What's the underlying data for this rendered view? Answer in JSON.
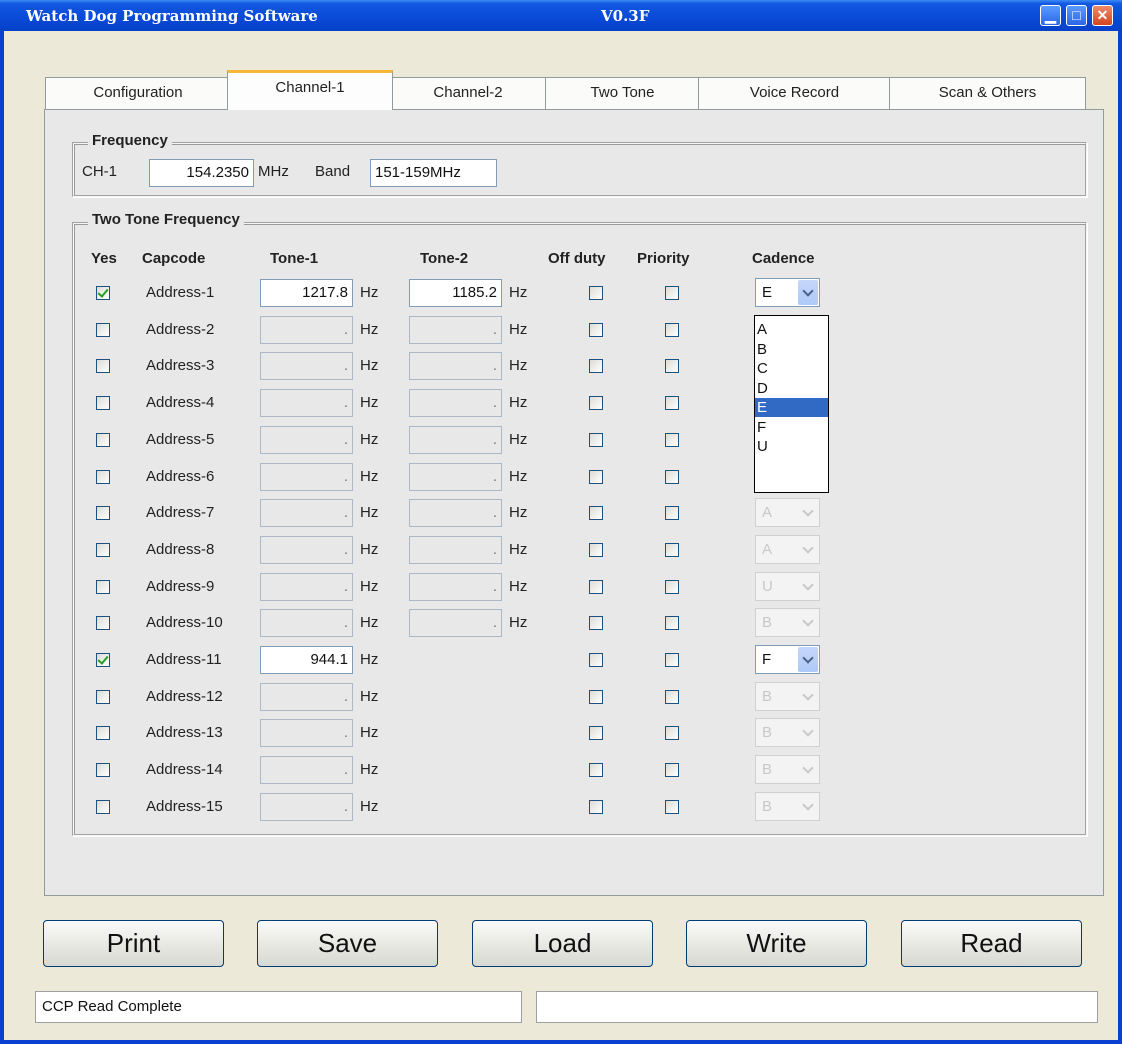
{
  "window": {
    "title": "Watch Dog Programming Software",
    "version": "V0.3F",
    "controls": {
      "minimize": "minimize-icon",
      "maximize": "maximize-icon",
      "close": "close-icon"
    }
  },
  "tabs": [
    {
      "label": "Configuration",
      "active": false
    },
    {
      "label": "Channel-1",
      "active": true
    },
    {
      "label": "Channel-2",
      "active": false
    },
    {
      "label": "Two Tone",
      "active": false
    },
    {
      "label": "Voice Record",
      "active": false
    },
    {
      "label": "Scan & Others",
      "active": false
    }
  ],
  "frequency": {
    "legend": "Frequency",
    "ch_label": "CH-1",
    "ch_value": "154.2350",
    "unit": "MHz",
    "band_label": "Band",
    "band_value": "151-159MHz"
  },
  "two_tone": {
    "legend": "Two Tone Frequency",
    "headers": {
      "yes": "Yes",
      "capcode": "Capcode",
      "tone1": "Tone-1",
      "tone2": "Tone-2",
      "offduty": "Off duty",
      "priority": "Priority",
      "cadence": "Cadence"
    },
    "hz": "Hz",
    "rows": [
      {
        "checked": true,
        "capcode": "Address-1",
        "tone1": "1217.8",
        "tone2": "1185.2",
        "cadence": "E",
        "enabled": true
      },
      {
        "checked": false,
        "capcode": "Address-2",
        "tone1": ".",
        "tone2": ".",
        "cadence": "",
        "enabled": false
      },
      {
        "checked": false,
        "capcode": "Address-3",
        "tone1": ".",
        "tone2": ".",
        "cadence": "",
        "enabled": false
      },
      {
        "checked": false,
        "capcode": "Address-4",
        "tone1": ".",
        "tone2": ".",
        "cadence": "",
        "enabled": false
      },
      {
        "checked": false,
        "capcode": "Address-5",
        "tone1": ".",
        "tone2": ".",
        "cadence": "",
        "enabled": false
      },
      {
        "checked": false,
        "capcode": "Address-6",
        "tone1": ".",
        "tone2": ".",
        "cadence": "",
        "enabled": false
      },
      {
        "checked": false,
        "capcode": "Address-7",
        "tone1": ".",
        "tone2": ".",
        "cadence": "A",
        "enabled": false
      },
      {
        "checked": false,
        "capcode": "Address-8",
        "tone1": ".",
        "tone2": ".",
        "cadence": "A",
        "enabled": false
      },
      {
        "checked": false,
        "capcode": "Address-9",
        "tone1": ".",
        "tone2": ".",
        "cadence": "U",
        "enabled": false
      },
      {
        "checked": false,
        "capcode": "Address-10",
        "tone1": ".",
        "tone2": ".",
        "cadence": "B",
        "enabled": false
      },
      {
        "checked": true,
        "capcode": "Address-11",
        "tone1": "944.1",
        "tone2": null,
        "cadence": "F",
        "enabled": true
      },
      {
        "checked": false,
        "capcode": "Address-12",
        "tone1": ".",
        "tone2": null,
        "cadence": "B",
        "enabled": false
      },
      {
        "checked": false,
        "capcode": "Address-13",
        "tone1": ".",
        "tone2": null,
        "cadence": "B",
        "enabled": false
      },
      {
        "checked": false,
        "capcode": "Address-14",
        "tone1": ".",
        "tone2": null,
        "cadence": "B",
        "enabled": false
      },
      {
        "checked": false,
        "capcode": "Address-15",
        "tone1": ".",
        "tone2": null,
        "cadence": "B",
        "enabled": false
      }
    ],
    "cadence_options": [
      "A",
      "B",
      "C",
      "D",
      "E",
      "F",
      "U"
    ],
    "cadence_highlighted": "E"
  },
  "buttons": {
    "print": "Print",
    "save": "Save",
    "load": "Load",
    "write": "Write",
    "read": "Read"
  },
  "status": {
    "message": "CCP Read Complete",
    "progress": ""
  },
  "colors": {
    "titlebar": "#0a4bd8",
    "active_tab_accent": "#f7b73a",
    "highlight": "#316ac5",
    "check": "#21a121"
  }
}
